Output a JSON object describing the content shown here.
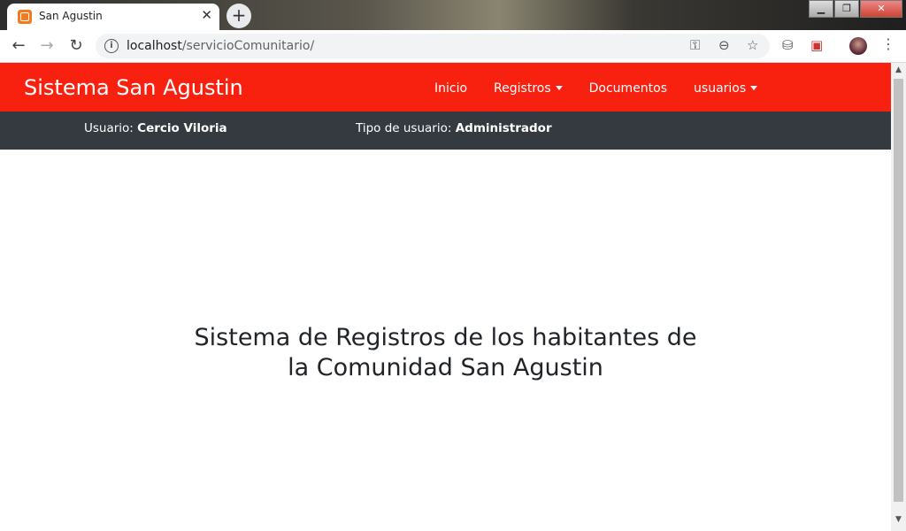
{
  "browser": {
    "tab_title": "San Agustin",
    "tab_close": "✕",
    "new_tab": "+",
    "url_host": "localhost",
    "url_path": "/servicioComunitario/"
  },
  "navbar": {
    "brand": "Sistema San Agustin",
    "links": [
      {
        "label": "Inicio",
        "dropdown": false
      },
      {
        "label": "Registros",
        "dropdown": true
      },
      {
        "label": "Documentos",
        "dropdown": false
      },
      {
        "label": "usuarios",
        "dropdown": true
      }
    ],
    "color": "#f8200e"
  },
  "userbar": {
    "usuario_label": "Usuario:",
    "usuario_value": "Cercio Viloria",
    "tipo_label": "Tipo de usuario:",
    "tipo_value": "Administrador",
    "color": "#343a40"
  },
  "main": {
    "headline_line1": "Sistema de Registros de los habitantes de",
    "headline_line2": "la Comunidad San Agustin"
  }
}
